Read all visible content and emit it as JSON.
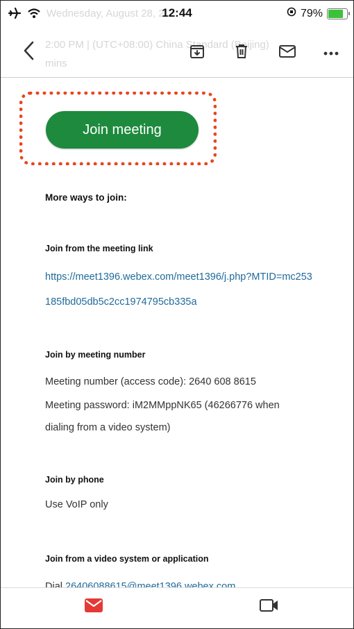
{
  "status_bar": {
    "time": "12:44",
    "battery": "79%",
    "battery_level": 0.79
  },
  "header": {
    "faded_line1": "Wednesday, August 28, 2",
    "faded_line2": "2:00 PM  |  (UTC+08:00) China Standard (Beijing)",
    "faded_line3": "mins"
  },
  "toolbar": {
    "back_icon": "chevron-left-icon",
    "archive_icon": "archive-icon",
    "delete_icon": "trash-icon",
    "mail_icon": "envelope-icon",
    "more_icon": "more-icon"
  },
  "join_button": {
    "label": "Join meeting",
    "color": "#1e8a3e",
    "highlight_color": "#e8461e"
  },
  "content": {
    "more_ways": "More ways to join:",
    "link_heading": "Join from the meeting link",
    "link_line1": "https://meet1396.webex.com/meet1396/j.php?MTID=mc253",
    "link_line2": "185fbd05db5c2cc1974795cb335a",
    "number_heading": "Join by meeting number",
    "meeting_number": "Meeting number (access code): 2640 608 8615",
    "password_line1": "Meeting password: iM2MMppNK65 (46266776 when",
    "password_line2": "dialing from a video system)",
    "phone_heading": "Join by phone",
    "phone_text": "Use VoIP only",
    "video_heading": "Join from a video system or application",
    "dial_prefix": "Dial ",
    "dial_link": "26406088615@meet1396.webex.com"
  },
  "tabbar": {
    "mail_icon": "mail-icon",
    "video_icon": "video-icon",
    "active_color": "#e53935"
  }
}
